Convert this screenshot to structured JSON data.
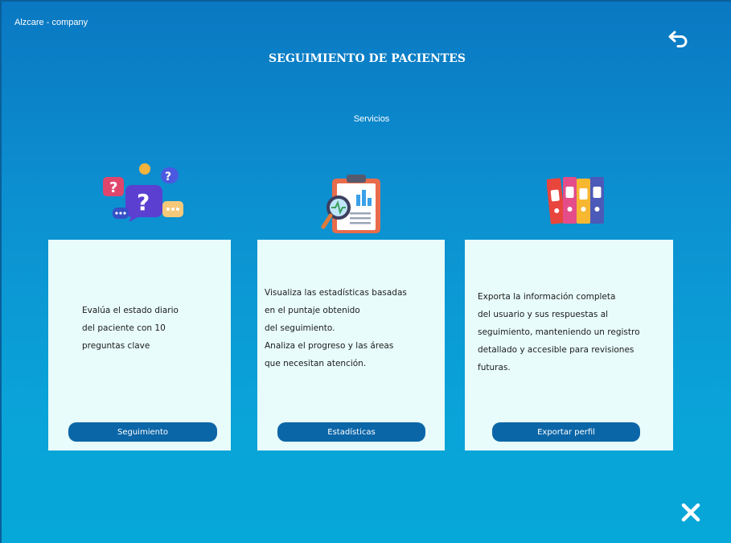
{
  "app": {
    "name": "Alzcare - company"
  },
  "header": {
    "title": "SEGUIMIENTO DE PACIENTES"
  },
  "section": {
    "label": "Servicios"
  },
  "cards": [
    {
      "icon": "question-bubbles-icon",
      "lines": [
        "Evalúa el estado diario",
        "del paciente con 10",
        "preguntas clave"
      ],
      "button": "Seguimiento"
    },
    {
      "icon": "clipboard-chart-icon",
      "lines": [
        "Visualiza las estadísticas basadas",
        "en el puntaje obtenido",
        "del seguimiento.",
        "Analiza el progreso y las áreas",
        "que necesitan atención."
      ],
      "button": "Estadísticas"
    },
    {
      "icon": "binders-icon",
      "lines": [
        "Exporta la información completa",
        "del usuario y sus respuestas al",
        "seguimiento, manteniendo un registro",
        "detallado y accesible para revisiones",
        "futuras."
      ],
      "button": "Exportar perfil"
    }
  ],
  "icons": {
    "back": "back-arrow-icon",
    "close": "close-icon"
  },
  "colors": {
    "background": "#0c8fd0",
    "card": "#e8fcfb",
    "button": "#0b66a8"
  }
}
